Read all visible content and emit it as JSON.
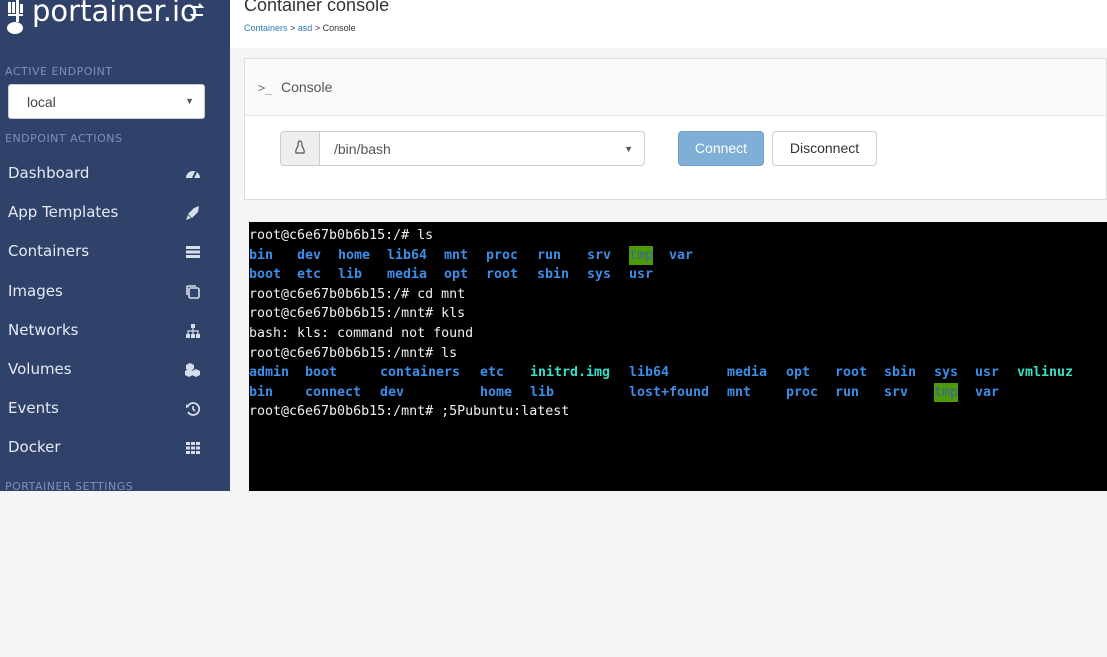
{
  "brand": {
    "name": "portainer.io"
  },
  "sidebar": {
    "active_endpoint_label": "ACTIVE ENDPOINT",
    "endpoint_value": "local",
    "endpoint_actions_label": "ENDPOINT ACTIONS",
    "items": [
      {
        "label": "Dashboard",
        "icon": "tachometer-icon"
      },
      {
        "label": "App Templates",
        "icon": "rocket-icon"
      },
      {
        "label": "Containers",
        "icon": "server-icon"
      },
      {
        "label": "Images",
        "icon": "clone-icon"
      },
      {
        "label": "Networks",
        "icon": "sitemap-icon"
      },
      {
        "label": "Volumes",
        "icon": "cubes-icon"
      },
      {
        "label": "Events",
        "icon": "history-icon"
      },
      {
        "label": "Docker",
        "icon": "th-icon"
      }
    ],
    "settings_label": "PORTAINER SETTINGS"
  },
  "header": {
    "title": "Container console",
    "breadcrumb": {
      "containers": "Containers",
      "sep1": " > ",
      "container": "asd",
      "sep2": " > ",
      "current": "Console"
    }
  },
  "console_panel": {
    "prompt_glyph": ">_",
    "title": "Console",
    "command_value": "/bin/bash",
    "connect_label": "Connect",
    "disconnect_label": "Disconnect"
  },
  "terminal": {
    "prompt_ls": "root@c6e67b0b6b15:/# ls",
    "root_row1": [
      "bin",
      "dev",
      "home",
      "lib64",
      "mnt",
      "proc",
      "run",
      "srv",
      "tmp",
      "var"
    ],
    "root_row2": [
      "boot",
      "etc",
      "lib",
      "media",
      "opt",
      "root",
      "sbin",
      "sys",
      "usr"
    ],
    "prompt_cd": "root@c6e67b0b6b15:/# cd mnt",
    "prompt_kls": "root@c6e67b0b6b15:/mnt# kls",
    "error_line": "bash: kls: command not found",
    "prompt_ls_mnt": "root@c6e67b0b6b15:/mnt# ls",
    "mnt_row1": [
      "admin",
      "boot",
      "containers",
      "etc",
      "initrd.img",
      "lib64",
      "media",
      "opt",
      "root",
      "sbin",
      "sys",
      "usr",
      "vmlinuz"
    ],
    "mnt_row2": [
      "bin",
      "connect",
      "dev",
      "home",
      "lib",
      "lost+found",
      "mnt",
      "proc",
      "run",
      "srv",
      "tmp",
      "var"
    ],
    "last_prompt": "root@c6e67b0b6b15:/mnt# ;5Pubuntu:latest"
  },
  "colors": {
    "sidebar_bg": "#30426a",
    "connect_btn": "#7faed7",
    "dir": "#3b8ee8",
    "exec": "#35e0c7",
    "sticky_bg": "#4e9a06"
  }
}
